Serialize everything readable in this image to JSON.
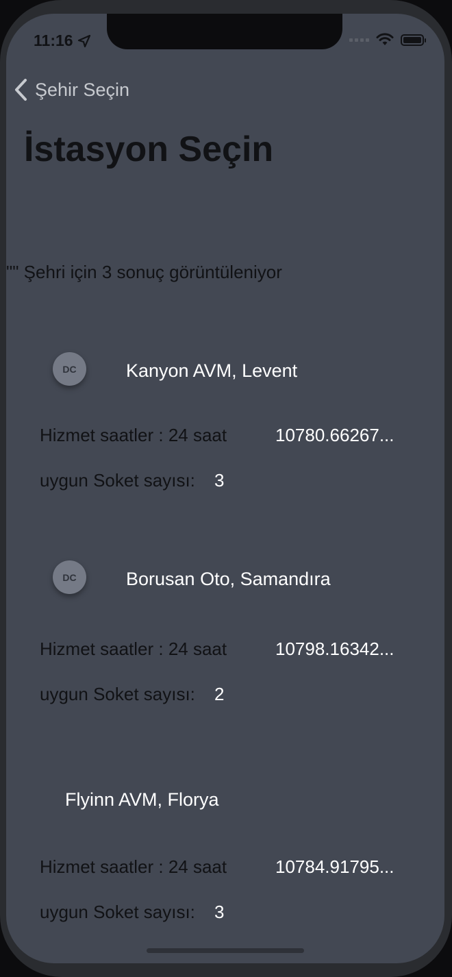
{
  "status_bar": {
    "time": "11:16"
  },
  "nav": {
    "back_label": "Şehir Seçin"
  },
  "title": "İstasyon Seçin",
  "result_text": "\"\" Şehri için 3 sonuç görüntüleniyor",
  "stations": [
    {
      "badge": "DC",
      "name": "Kanyon AVM, Levent",
      "hours": "Hizmet saatler : 24 saat",
      "distance": "10780.66267...",
      "sockets_label": "uygun Soket sayısı:",
      "sockets_value": "3"
    },
    {
      "badge": "DC",
      "name": "Borusan Oto, Samandıra",
      "hours": "Hizmet saatler : 24 saat",
      "distance": "10798.16342...",
      "sockets_label": "uygun Soket sayısı:",
      "sockets_value": "2"
    },
    {
      "badge": "",
      "name": "Flyinn AVM, Florya",
      "hours": "Hizmet saatler : 24 saat",
      "distance": "10784.91795...",
      "sockets_label": "uygun Soket sayısı:",
      "sockets_value": "3"
    }
  ],
  "colors": {
    "background": "#434853",
    "primary_text": "#111215",
    "accent_text": "#ffffff",
    "back_link": "#c7cacf",
    "badge": "#757a86"
  },
  "icons": {
    "back": "chevron-left-icon",
    "location": "location-arrow-icon",
    "wifi": "wifi-icon",
    "battery": "battery-icon",
    "signal": "signal-icon"
  }
}
